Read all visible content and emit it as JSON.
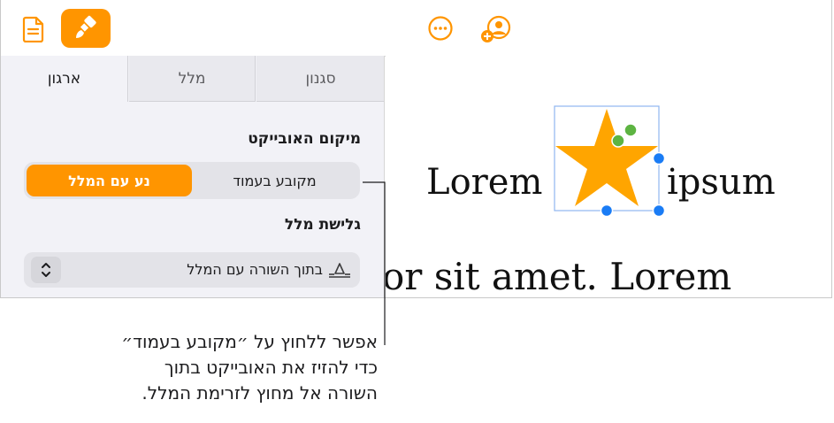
{
  "toolbar": {
    "document_icon": "document-icon",
    "format_icon": "paintbrush-icon",
    "more_icon": "ellipsis-circle-icon",
    "collaborate_icon": "add-person-icon",
    "accent_color": "#ff9500"
  },
  "sidebar": {
    "tabs": [
      {
        "label": "ארגון"
      },
      {
        "label": "מלל"
      },
      {
        "label": "סגנון"
      }
    ],
    "object_placement": {
      "title": "מיקום האובייקט",
      "options": [
        "נע עם המלל",
        "מקובע בעמוד"
      ],
      "selected": "נע עם המלל"
    },
    "text_wrap": {
      "title": "גלישת מלל",
      "value": "בתוך השורה עם המלל",
      "stepper_icon": "up-down-chevron-icon",
      "wrap_icon": "inline-wrap-icon"
    }
  },
  "canvas": {
    "word_before": "Lorem",
    "word_after": "ipsum",
    "line2": "or sit amet. Lorem",
    "star_color": "#ffa500",
    "selection_color": "#1a7cf5",
    "handle_green": "#5db442"
  },
  "callout": {
    "lines": [
      "אפשר ללחוץ על ״מקובע בעמוד״",
      "כדי להזיז את האובייקט בתוך",
      "השורה אל מחוץ לזרימת המלל."
    ]
  }
}
